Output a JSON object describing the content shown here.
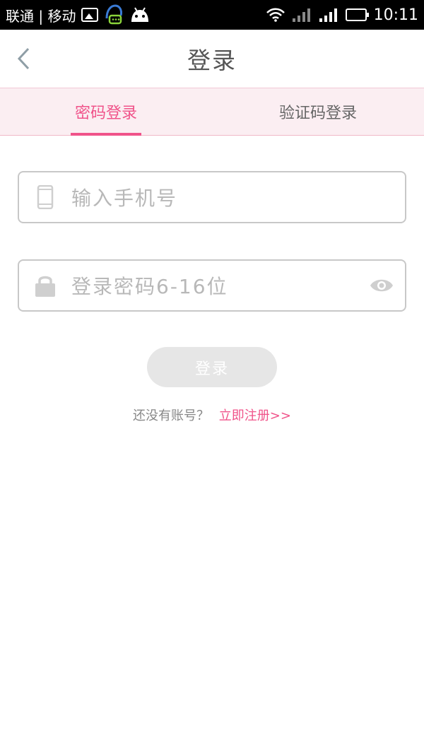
{
  "status_bar": {
    "carriers": "联通 | 移动",
    "time": "10:11"
  },
  "header": {
    "title": "登录"
  },
  "tabs": [
    {
      "label": "密码登录",
      "active": true
    },
    {
      "label": "验证码登录",
      "active": false
    }
  ],
  "form": {
    "phone_placeholder": "输入手机号",
    "password_placeholder": "登录密码6-16位",
    "login_label": "登录"
  },
  "register": {
    "prompt": "还没有账号？",
    "link": "立即注册>>"
  },
  "colors": {
    "accent": "#f0538a",
    "tab_bg": "#fbeef2",
    "button_disabled": "#e6e6e6"
  },
  "icons": [
    "back-arrow-icon",
    "phone-icon",
    "lock-icon",
    "eye-icon",
    "wifi-icon",
    "signal-icon",
    "battery-icon"
  ]
}
